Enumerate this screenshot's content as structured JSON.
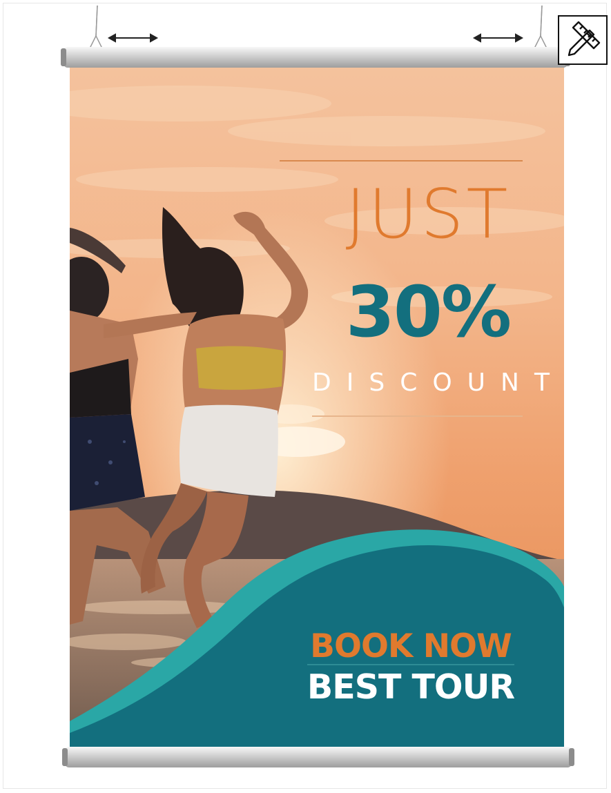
{
  "poster": {
    "headline": "JUST",
    "discount_value": "30%",
    "discount_label": "DISCOUNT",
    "cta_primary": "BOOK NOW",
    "cta_secondary": "BEST TOUR"
  },
  "toolbar": {
    "icon": "ruler-pencil-icon"
  },
  "colors": {
    "accent_orange": "#e07a2e",
    "teal": "#136f7e",
    "teal_light": "#2aa7a6",
    "sky": "#f3b787"
  }
}
